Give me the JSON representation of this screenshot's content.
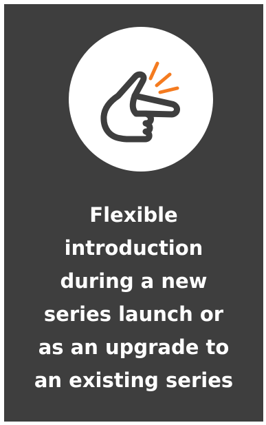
{
  "card": {
    "background": "#3e3e3e",
    "icon": "finger-snap-icon",
    "icon_stroke_color": "#3e3e3e",
    "icon_accent_color": "#f47b20",
    "caption_lines": [
      "Flexible",
      "introduction",
      "during a new",
      "series launch or",
      "as an upgrade to",
      "an existing series"
    ]
  }
}
